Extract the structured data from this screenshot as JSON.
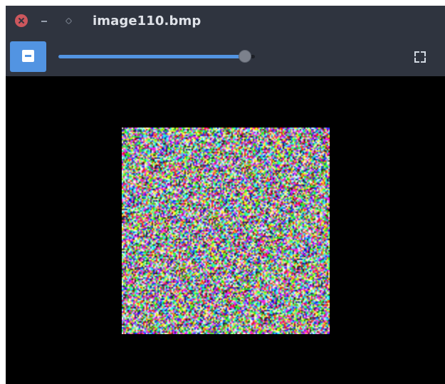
{
  "window": {
    "title": "image110.bmp",
    "controls": {
      "close_icon": "close-icon",
      "minimize_icon": "minimize-icon",
      "maximize_icon": "maximize-icon"
    }
  },
  "toolbar": {
    "zoom_out_icon": "zoom-out-icon",
    "zoom_slider_fraction": 0.95,
    "fullscreen_icon": "fullscreen-icon"
  },
  "viewer": {
    "image_description_colors": [
      "#ff3333",
      "#33ff66",
      "#3366ff",
      "#ffff33",
      "#ff33ff",
      "#33ffff",
      "#ffffff"
    ]
  },
  "colors": {
    "titlebar_bg": "#2f343f",
    "accent": "#5294e2",
    "close": "#cc575d",
    "canvas_bg": "#000000"
  }
}
